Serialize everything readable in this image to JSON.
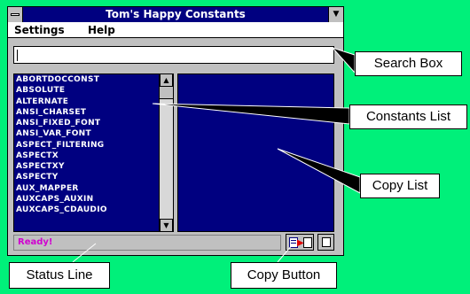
{
  "window": {
    "title": "Tom's Happy Constants",
    "menu": {
      "settings": "Settings",
      "help": "Help"
    },
    "search": {
      "value": ""
    },
    "constants_list": {
      "items": [
        "ABORTDOCCONST",
        "ABSOLUTE",
        "ALTERNATE",
        "ANSI_CHARSET",
        "ANSI_FIXED_FONT",
        "ANSI_VAR_FONT",
        "ASPECT_FILTERING",
        "ASPECTX",
        "ASPECTXY",
        "ASPECTY",
        "AUX_MAPPER",
        "AUXCAPS_AUXIN",
        "AUXCAPS_CDAUDIO"
      ]
    },
    "status": {
      "text": "Ready!"
    }
  },
  "callouts": {
    "search_box": "Search Box",
    "constants_list": "Constants List",
    "copy_list": "Copy List",
    "status_line": "Status Line",
    "copy_button": "Copy Button"
  },
  "colors": {
    "background": "#00f07a",
    "titlebar": "#000080",
    "list_bg": "#000080",
    "status_text": "#d000d0"
  }
}
